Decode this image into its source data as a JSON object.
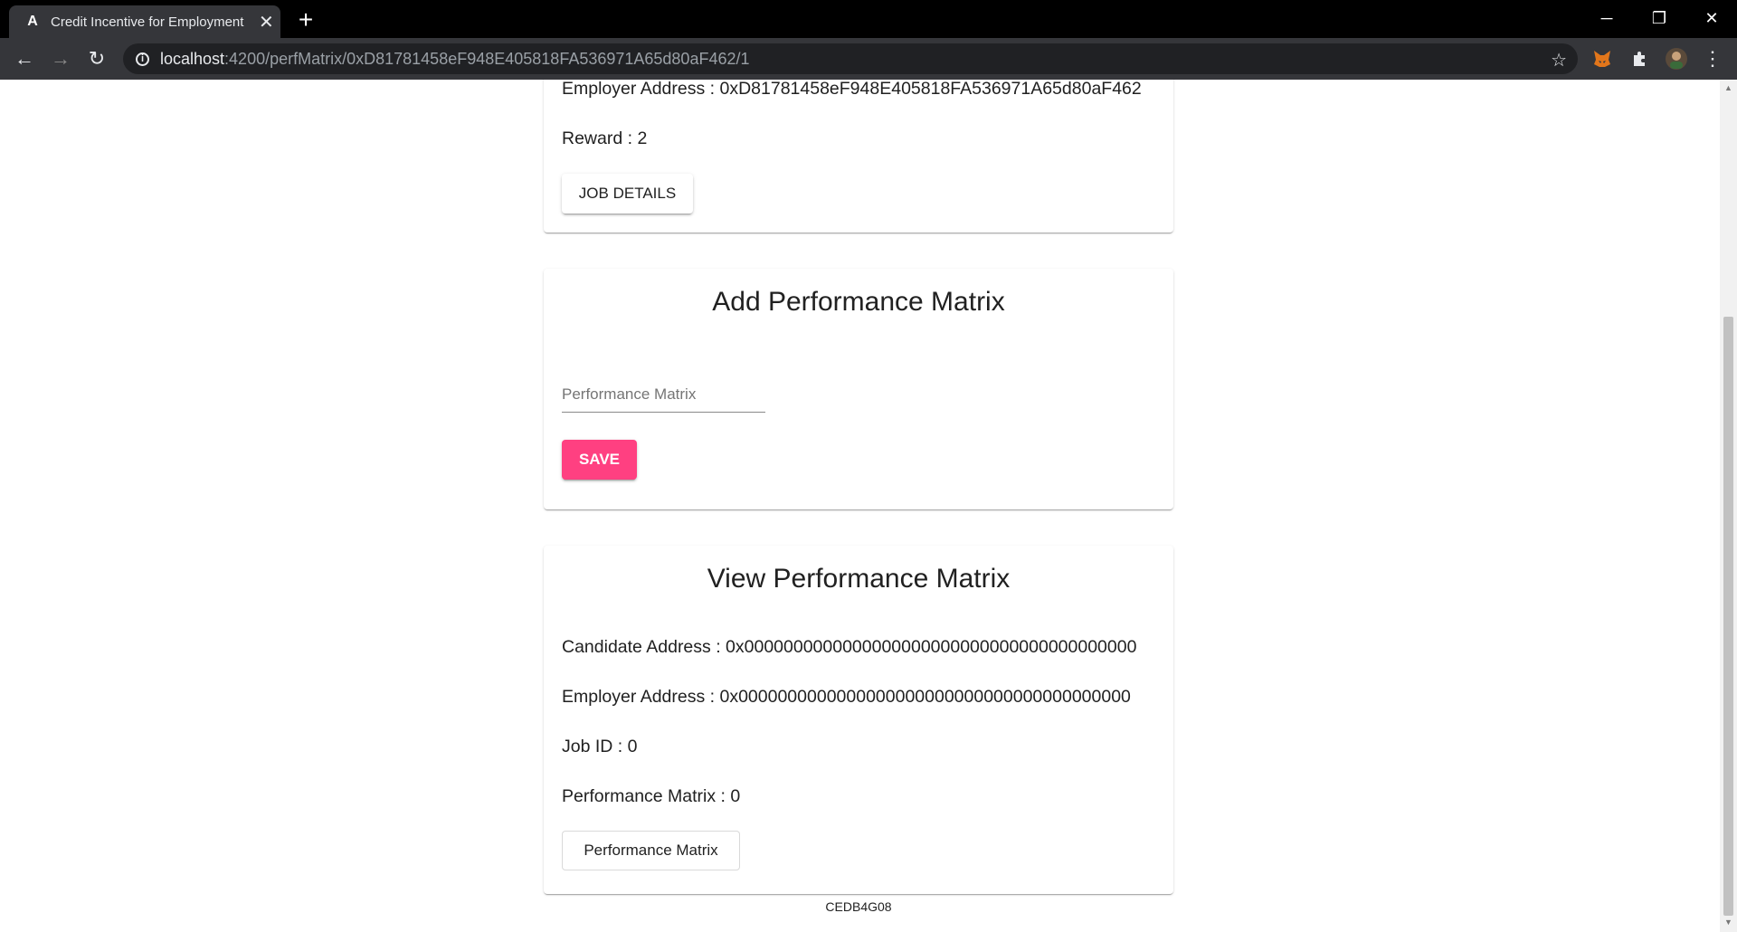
{
  "browser": {
    "tab_title": "Credit Incentive for Employment",
    "tab_favicon": "A",
    "url_host": "localhost",
    "url_path": ":4200/perfMatrix/0xD81781458eF948E405818FA536971A65d80aF462/1"
  },
  "job_card": {
    "employer_address": "Employer Address : 0xD81781458eF948E405818FA536971A65d80aF462",
    "reward": "Reward : 2",
    "button_label": "JOB DETAILS"
  },
  "add_card": {
    "title": "Add Performance Matrix",
    "input_placeholder": "Performance Matrix",
    "input_value": "",
    "save_label": "SAVE"
  },
  "view_card": {
    "title": "View Performance Matrix",
    "candidate_address": "Candidate Address : 0x0000000000000000000000000000000000000000",
    "employer_address": "Employer Address : 0x0000000000000000000000000000000000000000",
    "job_id": "Job ID : 0",
    "performance_matrix": "Performance Matrix : 0",
    "button_label": "Performance Matrix"
  },
  "footer": {
    "code": "CEDB4G08"
  },
  "colors": {
    "accent": "#ff4081",
    "chrome_dark": "#35363a"
  }
}
